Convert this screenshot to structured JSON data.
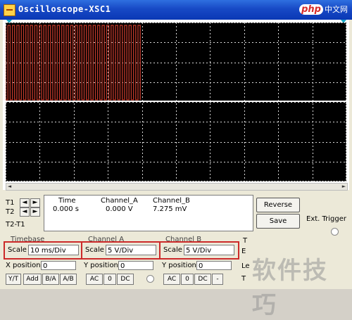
{
  "window": {
    "title": "Oscilloscope-XSC1"
  },
  "watermark_top": {
    "brand": "php",
    "text": "中文网"
  },
  "cursor_labels": {
    "t1": "T1",
    "t2": "T2",
    "diff": "T2-T1"
  },
  "readout": {
    "headers": {
      "time": "Time",
      "channel_a": "Channel_A",
      "channel_b": "Channel_B"
    },
    "values": {
      "time": "0.000 s",
      "channel_a": "0.000 V",
      "channel_b": "7.275 mV"
    }
  },
  "buttons": {
    "reverse": "Reverse",
    "save": "Save"
  },
  "ext_trigger": {
    "label": "Ext. Trigger"
  },
  "timebase": {
    "group": "Timebase",
    "scale_label": "Scale",
    "scale_value": "10 ms/Div",
    "pos_label": "X position",
    "pos_value": "0",
    "modes": [
      "Y/T",
      "Add",
      "B/A",
      "A/B"
    ]
  },
  "channel_a": {
    "group": "Channel A",
    "scale_label": "Scale",
    "scale_value": "5  V/Div",
    "pos_label": "Y position",
    "pos_value": "0",
    "coupling": [
      "AC",
      "0",
      "DC"
    ]
  },
  "channel_b": {
    "group": "Channel B",
    "scale_label": "Scale",
    "scale_value": "5  V/Div",
    "pos_label": "Y position",
    "pos_value": "0",
    "coupling": [
      "AC",
      "0",
      "DC",
      "-"
    ]
  },
  "trigger_cut": {
    "t1": "T",
    "t2": "E",
    "t3": "Le",
    "t4": "T"
  },
  "watermark_bottom": "软件技巧",
  "colors": {
    "trace_a": "#c0392b",
    "grid": "#d8d8d8",
    "title_bar": "#1749c5",
    "highlight": "#cc2a2a"
  },
  "trace": {
    "channel_a_burst_fraction": 0.395,
    "burst_cycles": 60
  }
}
